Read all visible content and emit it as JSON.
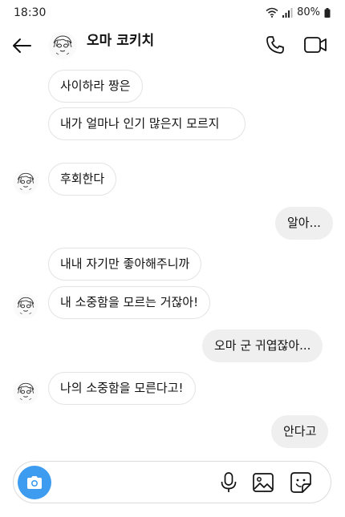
{
  "status_bar": {
    "time": "18:30",
    "battery": "80%"
  },
  "header": {
    "contact_name": "오마 코키치"
  },
  "messages": [
    {
      "side": "in",
      "text": "사이하라 짱은"
    },
    {
      "side": "in",
      "text": "내가 얼마나 인기 많은지 모르지"
    },
    {
      "side": "in",
      "text": "후회한다"
    },
    {
      "side": "out",
      "text": "알아..."
    },
    {
      "side": "in",
      "text": "내내 자기만 좋아해주니까"
    },
    {
      "side": "in",
      "text": "내 소중함을 모르는 거잖아!"
    },
    {
      "side": "out",
      "text": "오마 군 귀엽잖아..."
    },
    {
      "side": "in",
      "text": "나의 소중함을 모른다고!"
    },
    {
      "side": "out",
      "text": "안다고"
    }
  ],
  "composer": {
    "placeholder": ""
  },
  "icons": {
    "back": "arrow-left-icon",
    "call": "phone-icon",
    "video": "video-camera-icon",
    "camera": "camera-icon",
    "mic": "microphone-icon",
    "gallery": "image-icon",
    "sticker": "sticker-icon"
  },
  "colors": {
    "camera_button": "#3d9bf0",
    "outgoing_bubble": "#efefef",
    "incoming_border": "#e3e3e3"
  }
}
